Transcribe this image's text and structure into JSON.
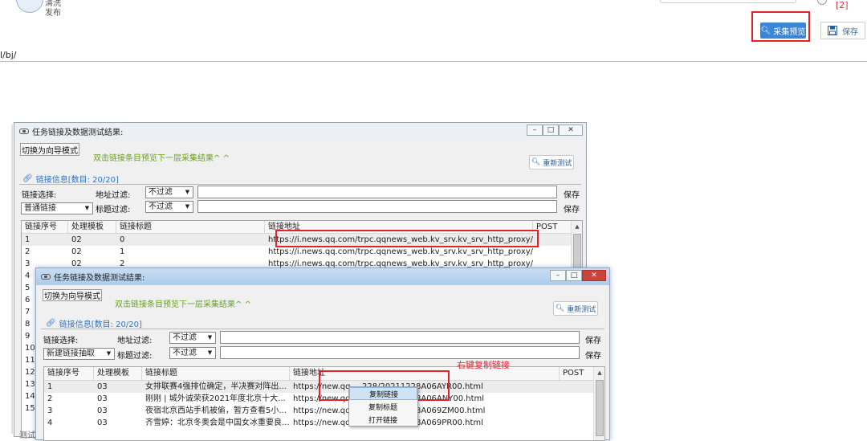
{
  "header": {
    "logo_text_line1": "清洗",
    "logo_text_line2": "发布",
    "tag": "[2]",
    "preview_label": "采集预览",
    "save_label": "保存",
    "path": "l/bj/"
  },
  "window1": {
    "title": "任务链接及数据测试结果:",
    "guide_button": "切换为向导模式",
    "hint": "双击链接条目预览下一层采集结果^ ^",
    "retest": "重新测试",
    "tab": "链接信息[数目: 20/20]",
    "link_select_label": "链接选择:",
    "link_select_value": "普通链接",
    "addr_filter_label": "地址过滤:",
    "addr_filter_value": "不过滤",
    "title_filter_label": "标题过滤:",
    "title_filter_value": "不过滤",
    "save1": "保存",
    "save2": "保存",
    "columns": [
      "链接序号",
      "处理模板",
      "链接标题",
      "链接地址",
      "POST"
    ],
    "rows": [
      [
        "1",
        "02",
        "0",
        "https://i.news.qq.com/trpc.qqnews_web.kv_srv.kv_srv_http_proxy/lis..."
      ],
      [
        "2",
        "02",
        "1",
        "https://i.news.qq.com/trpc.qqnews_web.kv_srv.kv_srv_http_proxy/lis..."
      ],
      [
        "3",
        "02",
        "2",
        "https://i.news.qq.com/trpc.qqnews_web.kv_srv.kv_srv_http_proxy/lis..."
      ],
      [
        "4",
        "",
        "",
        ""
      ],
      [
        "5",
        "",
        "",
        ""
      ],
      [
        "6",
        "",
        "",
        ""
      ],
      [
        "7",
        "",
        "",
        ""
      ],
      [
        "8",
        "",
        "",
        ""
      ],
      [
        "9",
        "",
        "",
        ""
      ],
      [
        "10",
        "",
        "",
        ""
      ],
      [
        "11",
        "",
        "",
        ""
      ],
      [
        "12",
        "",
        "",
        ""
      ],
      [
        "13",
        "",
        "",
        ""
      ],
      [
        "14",
        "",
        "",
        ""
      ],
      [
        "15",
        "",
        "",
        ""
      ]
    ],
    "bottom_label": "测试"
  },
  "window2": {
    "title": "任务链接及数据测试结果:",
    "guide_button": "切换为向导模式",
    "hint": "双击链接条目预览下一层采集结果^ ^",
    "retest": "重新测试",
    "tab": "链接信息[数目: 20/20]",
    "link_select_label": "链接选择:",
    "link_select_value": "新建链接抽取",
    "addr_filter_label": "地址过滤:",
    "addr_filter_value": "不过滤",
    "title_filter_label": "标题过滤:",
    "title_filter_value": "不过滤",
    "save1": "保存",
    "save2": "保存",
    "columns": [
      "链接序号",
      "处理模板",
      "链接标题",
      "链接地址",
      "POST"
    ],
    "rows": [
      [
        "1",
        "03",
        "女排联赛4强排位确定，半决赛对阵出...",
        "https://new.qq",
        "228/20211228A06AYR00.html"
      ],
      [
        "2",
        "03",
        "刚刚 | 城外诚荣获2021年度北京十大...",
        "https://new.qq",
        "228/20211228A06ANY00.html"
      ],
      [
        "3",
        "03",
        "夜宿北京西站手机被偷，暂方查看5小...",
        "https://new.qq",
        "228/20211228A069ZM00.html"
      ],
      [
        "4",
        "03",
        "齐雪婷：北京冬奥会是中国女冰重要良...",
        "https://new.qq",
        "228/20211228A069PR00.html"
      ]
    ]
  },
  "annotation": "右键复制链接",
  "context_menu": [
    "复制链接",
    "复制标题",
    "打开链接"
  ]
}
